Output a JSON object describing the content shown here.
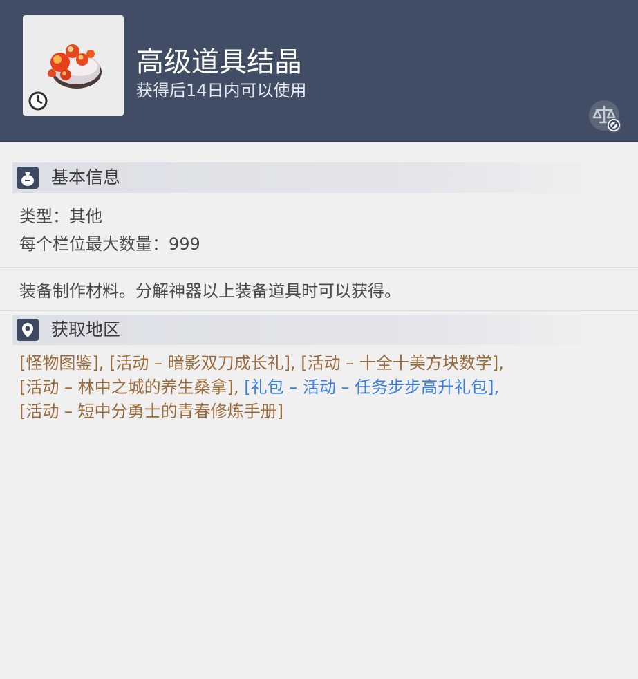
{
  "item": {
    "name": "高级道具结晶",
    "subtitle": "获得后14日内可以使用",
    "icon": "orange-crystal-item-icon",
    "time_limit_icon": "clock-icon",
    "trade_icon": "untradeable-scale-icon"
  },
  "basic_info": {
    "title": "基本信息",
    "icon": "bag-icon",
    "type_line": "类型：其他",
    "max_stack_line": "每个栏位最大数量：999"
  },
  "description": "装备制作材料。分解神器以上装备道具时可以获得。",
  "sources": {
    "title": "获取地区",
    "icon": "map-pin-icon",
    "lines": [
      [
        {
          "text": "[怪物图鉴]",
          "link": false
        },
        {
          "text": ", ",
          "link": false
        },
        {
          "text": "[活动 – 暗影双刀成长礼]",
          "link": false
        },
        {
          "text": ", ",
          "link": false
        },
        {
          "text": "[活动 – 十全十美方块数学]",
          "link": false
        },
        {
          "text": ",",
          "link": false
        }
      ],
      [
        {
          "text": "[活动 – 林中之城的养生桑拿]",
          "link": false
        },
        {
          "text": ", ",
          "link": false
        },
        {
          "text": "[礼包 – 活动 – 任务步步高升礼包]",
          "link": true
        },
        {
          "text": ",",
          "link": true
        }
      ],
      [
        {
          "text": "[活动 – 短中分勇士的青春修炼手册]",
          "link": false
        }
      ]
    ]
  },
  "colors": {
    "header_bg": "#414d64",
    "panel_bg": "#f0f0f0",
    "source_text": "#9a6b3c",
    "link_text": "#3a7fe0"
  }
}
